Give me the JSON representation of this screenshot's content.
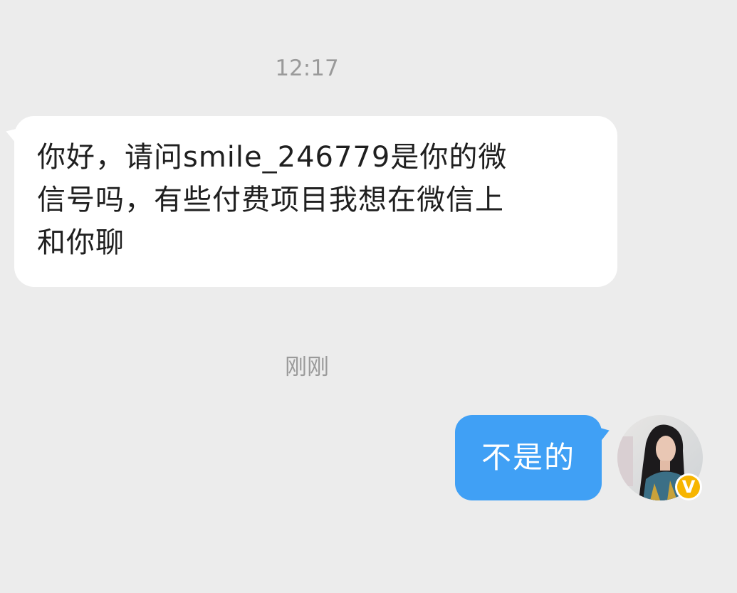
{
  "chat": {
    "timestamps": [
      "12:17",
      "刚刚"
    ],
    "incoming_message": {
      "text": "你好，请问smile_246779是你的微\n信号吗，有些付费项目我想在微信上\n和你聊"
    },
    "outgoing_message": {
      "text": "不是的"
    },
    "avatar": {
      "badge_letter": "V",
      "badge_color": "#f7b500"
    }
  },
  "colors": {
    "background": "#ececec",
    "incoming_bubble": "#ffffff",
    "outgoing_bubble": "#40a0f5",
    "timestamp_text": "#9a9a9a"
  }
}
